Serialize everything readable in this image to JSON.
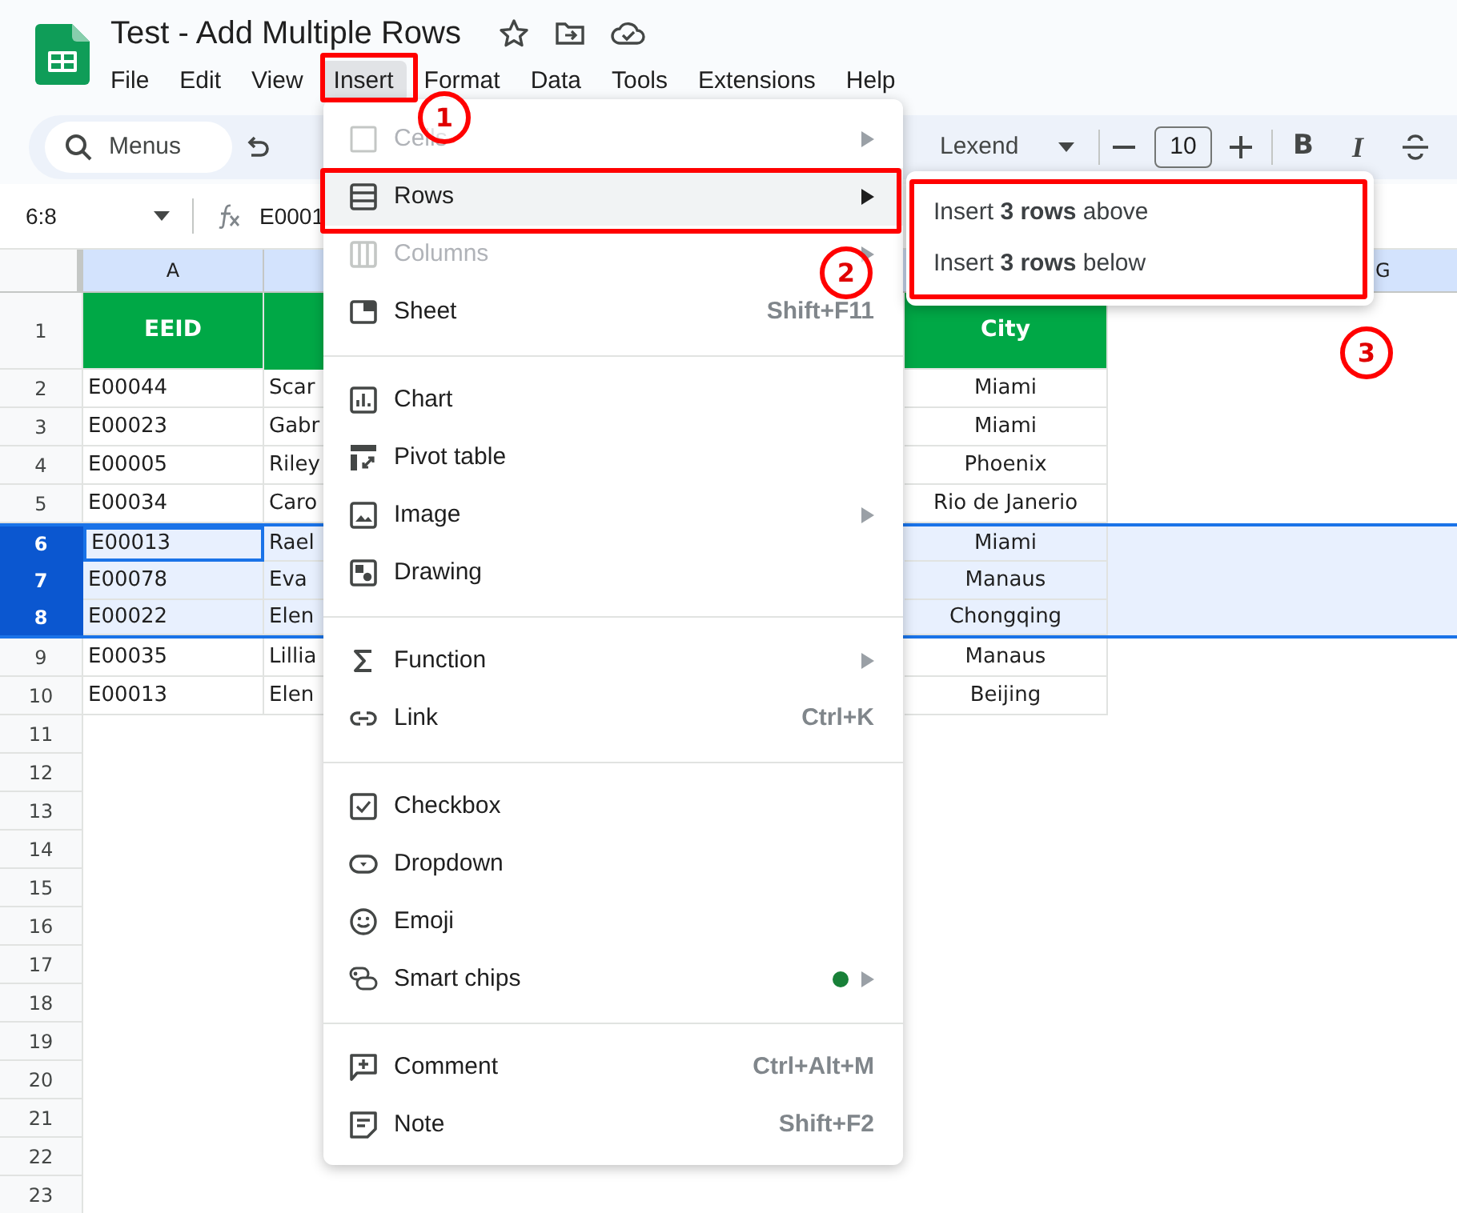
{
  "document": {
    "title": "Test - Add Multiple Rows"
  },
  "menu_bar": [
    {
      "label": "File",
      "selected": false
    },
    {
      "label": "Edit",
      "selected": false
    },
    {
      "label": "View",
      "selected": false
    },
    {
      "label": "Insert",
      "selected": true
    },
    {
      "label": "Format",
      "selected": false
    },
    {
      "label": "Data",
      "selected": false
    },
    {
      "label": "Tools",
      "selected": false
    },
    {
      "label": "Extensions",
      "selected": false
    },
    {
      "label": "Help",
      "selected": false
    }
  ],
  "toolbar": {
    "search": {
      "placeholder": "Menus"
    },
    "font": "Lexend",
    "font_size": "10",
    "bold": "B",
    "italic": "I"
  },
  "formula_bar": {
    "name_box": "6:8",
    "formula": "E0001"
  },
  "column_headers": [
    {
      "label": "A"
    },
    {
      "label": "G"
    }
  ],
  "rows": [
    {
      "number": "1",
      "kind": "header",
      "selected": false,
      "active": false,
      "cells": [
        "EEID",
        "City"
      ]
    },
    {
      "number": "2",
      "kind": "data",
      "selected": false,
      "active": false,
      "cells": [
        "E00044",
        "Scar",
        "Miami"
      ]
    },
    {
      "number": "3",
      "kind": "data",
      "selected": false,
      "active": false,
      "cells": [
        "E00023",
        "Gabr",
        "Miami"
      ]
    },
    {
      "number": "4",
      "kind": "data",
      "selected": false,
      "active": false,
      "cells": [
        "E00005",
        "Riley",
        "Phoenix"
      ]
    },
    {
      "number": "5",
      "kind": "data",
      "selected": false,
      "active": false,
      "cells": [
        "E00034",
        "Caro",
        "Rio de Janerio"
      ]
    },
    {
      "number": "6",
      "kind": "data",
      "selected": true,
      "active": true,
      "cells": [
        "E00013",
        "Rael",
        "Miami"
      ]
    },
    {
      "number": "7",
      "kind": "data",
      "selected": true,
      "active": false,
      "cells": [
        "E00078",
        "Eva",
        "Manaus"
      ]
    },
    {
      "number": "8",
      "kind": "data",
      "selected": true,
      "active": false,
      "cells": [
        "E00022",
        "Elen",
        "Chongqing"
      ]
    },
    {
      "number": "9",
      "kind": "data",
      "selected": false,
      "active": false,
      "cells": [
        "E00035",
        "Lillia",
        "Manaus"
      ]
    },
    {
      "number": "10",
      "kind": "data",
      "selected": false,
      "active": false,
      "cells": [
        "E00013",
        "Elen",
        "Beijing"
      ]
    },
    {
      "number": "11",
      "kind": "empty",
      "selected": false,
      "active": false
    },
    {
      "number": "12",
      "kind": "empty",
      "selected": false,
      "active": false
    },
    {
      "number": "13",
      "kind": "empty",
      "selected": false,
      "active": false
    },
    {
      "number": "14",
      "kind": "empty",
      "selected": false,
      "active": false
    },
    {
      "number": "15",
      "kind": "empty",
      "selected": false,
      "active": false
    },
    {
      "number": "16",
      "kind": "empty",
      "selected": false,
      "active": false
    },
    {
      "number": "17",
      "kind": "empty",
      "selected": false,
      "active": false
    },
    {
      "number": "18",
      "kind": "empty",
      "selected": false,
      "active": false
    },
    {
      "number": "19",
      "kind": "empty",
      "selected": false,
      "active": false
    },
    {
      "number": "20",
      "kind": "empty",
      "selected": false,
      "active": false
    },
    {
      "number": "21",
      "kind": "empty",
      "selected": false,
      "active": false
    },
    {
      "number": "22",
      "kind": "empty",
      "selected": false,
      "active": false
    },
    {
      "number": "23",
      "kind": "empty",
      "selected": false,
      "active": false
    }
  ],
  "insert_menu": {
    "groups": [
      [
        {
          "label": "Cells",
          "submenu": true,
          "disabled": true,
          "selected": false,
          "new_dot": false
        },
        {
          "label": "Rows",
          "submenu": true,
          "disabled": false,
          "selected": true,
          "new_dot": false
        },
        {
          "label": "Columns",
          "submenu": true,
          "disabled": true,
          "selected": false,
          "new_dot": false
        },
        {
          "label": "Sheet",
          "shortcut": "Shift+F11",
          "submenu": false,
          "disabled": false,
          "selected": false,
          "new_dot": false
        }
      ],
      [
        {
          "label": "Chart",
          "submenu": false,
          "disabled": false,
          "selected": false,
          "new_dot": false
        },
        {
          "label": "Pivot table",
          "submenu": false,
          "disabled": false,
          "selected": false,
          "new_dot": false
        },
        {
          "label": "Image",
          "submenu": true,
          "disabled": false,
          "selected": false,
          "new_dot": false
        },
        {
          "label": "Drawing",
          "submenu": false,
          "disabled": false,
          "selected": false,
          "new_dot": false
        }
      ],
      [
        {
          "label": "Function",
          "submenu": true,
          "disabled": false,
          "selected": false,
          "new_dot": false
        },
        {
          "label": "Link",
          "shortcut": "Ctrl+K",
          "submenu": false,
          "disabled": false,
          "selected": false,
          "new_dot": false
        }
      ],
      [
        {
          "label": "Checkbox",
          "submenu": false,
          "disabled": false,
          "selected": false,
          "new_dot": false
        },
        {
          "label": "Dropdown",
          "submenu": false,
          "disabled": false,
          "selected": false,
          "new_dot": false
        },
        {
          "label": "Emoji",
          "submenu": false,
          "disabled": false,
          "selected": false,
          "new_dot": false
        },
        {
          "label": "Smart chips",
          "submenu": true,
          "disabled": false,
          "selected": false,
          "new_dot": true
        }
      ],
      [
        {
          "label": "Comment",
          "shortcut": "Ctrl+Alt+M",
          "submenu": false,
          "disabled": false,
          "selected": false,
          "new_dot": false
        },
        {
          "label": "Note",
          "shortcut": "Shift+F2",
          "submenu": false,
          "disabled": false,
          "selected": false,
          "new_dot": false
        }
      ]
    ]
  },
  "rows_submenu": [
    {
      "label": "Insert **3 rows** above"
    },
    {
      "label": "Insert **3 rows** below"
    }
  ],
  "callouts": [
    {
      "number": "1"
    },
    {
      "number": "2"
    },
    {
      "number": "3"
    }
  ]
}
